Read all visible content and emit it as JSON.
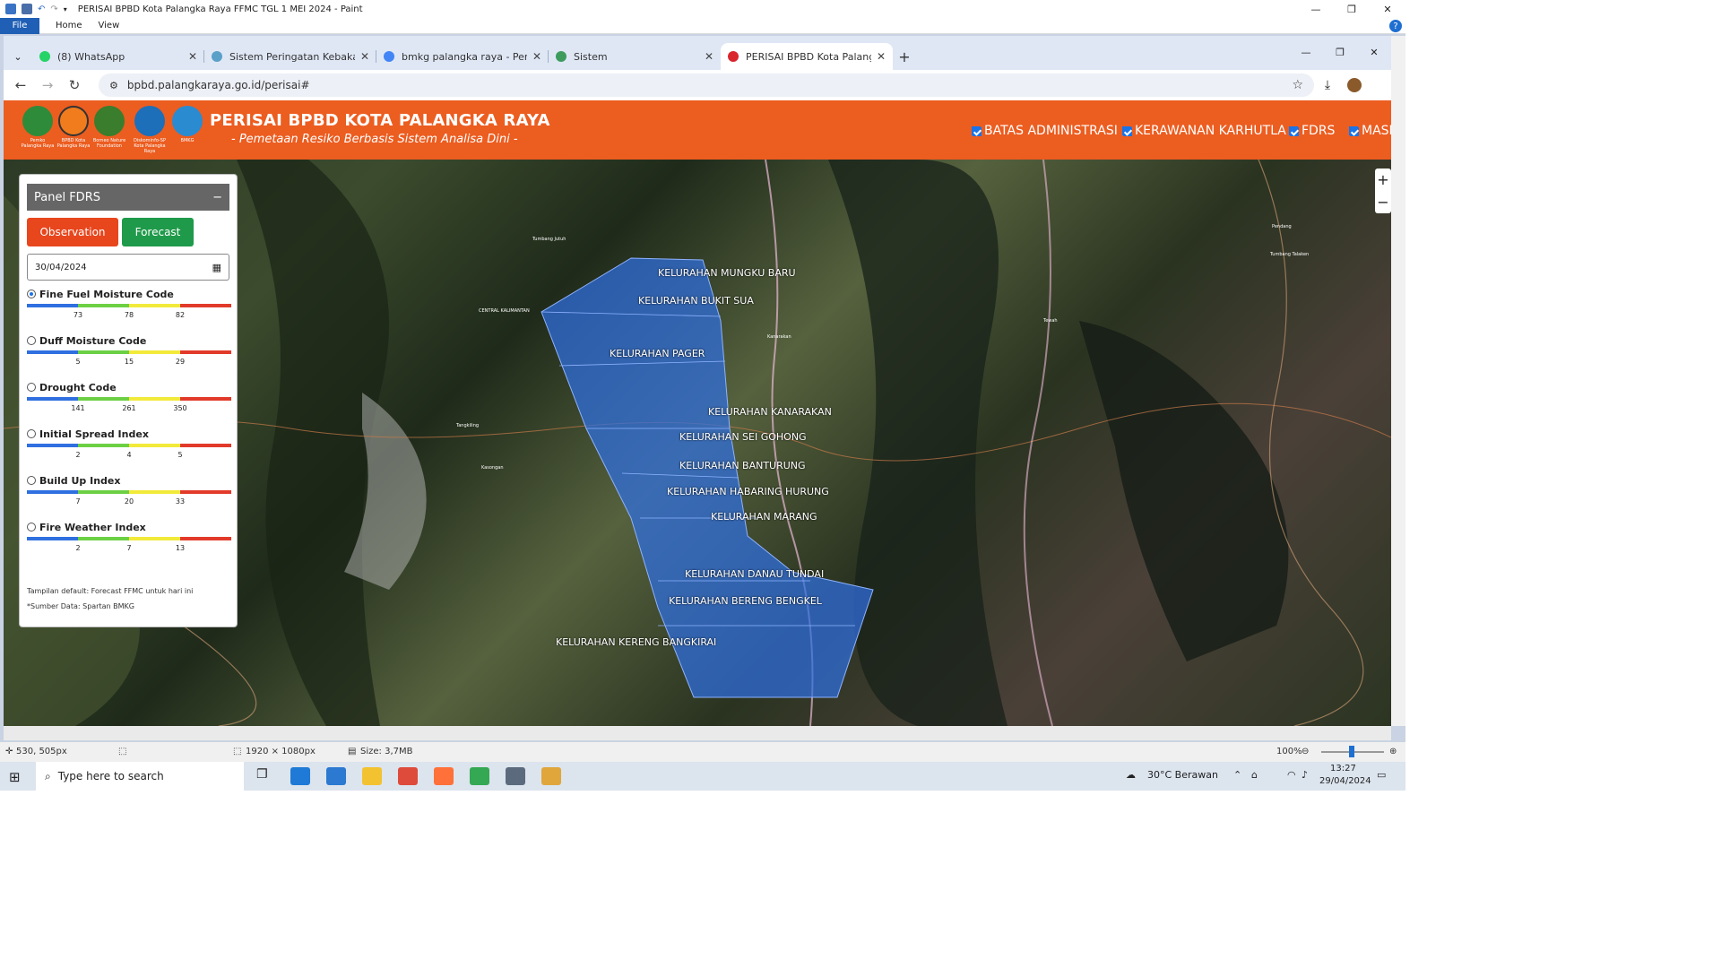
{
  "paint": {
    "title": "PERISAI BPBD Kota Palangka Raya FFMC TGL 1 MEI  2024 - Paint",
    "ribbon": {
      "file": "File",
      "home": "Home",
      "view": "View",
      "help": "?"
    },
    "window_controls": {
      "minimize": "—",
      "maximize": "❐",
      "close": "✕"
    },
    "status": {
      "cursor": "530, 505px",
      "dimensions": "1920 × 1080px",
      "size": "Size: 3,7MB",
      "zoom": "100%"
    }
  },
  "browser": {
    "tabs": [
      {
        "title": "(8) WhatsApp",
        "favicon_color": "#25d366"
      },
      {
        "title": "Sistem Peringatan Kebakaran H",
        "favicon_color": "#5aa0c8"
      },
      {
        "title": "bmkg palangka raya - Penelusu",
        "favicon_color": "#4285f4"
      },
      {
        "title": "Sistem",
        "favicon_color": "#3e9b5e"
      },
      {
        "title": "PERISAI BPBD Kota Palangka Ra",
        "favicon_color": "#d9262c",
        "active": true
      }
    ],
    "new_tab": "+",
    "url": "bpbd.palangkaraya.go.id/perisai#"
  },
  "header": {
    "title": "PERISAI BPBD KOTA PALANGKA RAYA",
    "subtitle": "- Pemetaan Resiko Berbasis Sistem Analisa Dini -",
    "logos": [
      {
        "caption": "Pemko Palangka Raya",
        "color": "#2e8b3a"
      },
      {
        "caption": "BPBD Kota Palangka Raya",
        "color": "#f07c1d"
      },
      {
        "caption": "Borneo Nature Foundation",
        "color": "#3a7d2c"
      },
      {
        "caption": "Diskominfo-SP Kota Palangka Raya",
        "color": "#1c6fb8"
      },
      {
        "caption": "BMKG",
        "color": "#2a8bd0"
      }
    ],
    "layers": [
      {
        "label": "BATAS ADMINISTRASI",
        "checked": true
      },
      {
        "label": "KERAWANAN KARHUTLA",
        "checked": true
      },
      {
        "label": "FDRS",
        "checked": true
      },
      {
        "label": "MASK",
        "checked": true
      }
    ]
  },
  "panel": {
    "title": "Panel FDRS",
    "minimize": "−",
    "observation": "Observation",
    "forecast": "Forecast",
    "date": "30/04/2024",
    "indices": [
      {
        "name": "Fine Fuel Moisture Code",
        "selected": true,
        "ticks": [
          "73",
          "78",
          "82"
        ]
      },
      {
        "name": "Duff Moisture Code",
        "selected": false,
        "ticks": [
          "5",
          "15",
          "29"
        ]
      },
      {
        "name": "Drought Code",
        "selected": false,
        "ticks": [
          "141",
          "261",
          "350"
        ]
      },
      {
        "name": "Initial Spread Index",
        "selected": false,
        "ticks": [
          "2",
          "4",
          "5"
        ]
      },
      {
        "name": "Build Up Index",
        "selected": false,
        "ticks": [
          "7",
          "20",
          "33"
        ]
      },
      {
        "name": "Fire Weather Index",
        "selected": false,
        "ticks": [
          "2",
          "7",
          "13"
        ]
      }
    ],
    "scale_colors": [
      "#2f6fe0",
      "#6cd044",
      "#f2ea3a",
      "#e23a2a"
    ],
    "note1": "Tampilan default: Forecast FFMC untuk hari ini",
    "note2": "*Sumber Data: Spartan BMKG"
  },
  "map": {
    "zoom_in": "+",
    "zoom_out": "−",
    "kelurahan": [
      "KELURAHAN MUNGKU BARU",
      "KELURAHAN BUKIT SUA",
      "KELURAHAN PAGER",
      "KELURAHAN KANARAKAN",
      "KELURAHAN SEI GOHONG",
      "KELURAHAN BANTURUNG",
      "KELURAHAN HABARING HURUNG",
      "KELURAHAN MARANG",
      "KELURAHAN DANAU TUNDAI",
      "KELURAHAN BERENG BENGKEL",
      "KELURAHAN KERENG BANGKIRAI"
    ],
    "places": [
      "CENTRAL KALIMANTAN",
      "Tumbang Jutuh",
      "Tangkiling",
      "Kasongan",
      "Kanarakan",
      "Pendang",
      "Tewah",
      "Tumbang Talaken"
    ]
  },
  "taskbar": {
    "search_placeholder": "Type here to search",
    "weather": "30°C  Berawan",
    "time": "13:27",
    "date": "29/04/2024"
  }
}
